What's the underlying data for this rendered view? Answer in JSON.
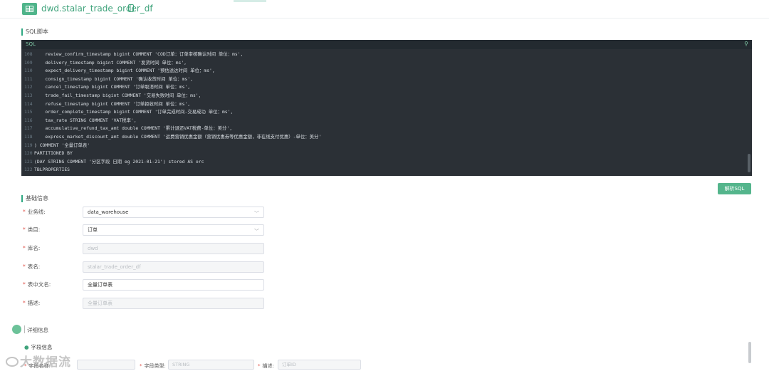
{
  "header": {
    "table_name": "dwd.stalar_trade_order_df"
  },
  "sql_section": {
    "title": "SQL脚本",
    "editor_label": "SQL",
    "lines": [
      {
        "n": "108",
        "code": "    review_confirm_timestamp bigint COMMENT 'COD订单：订单审核确认时间 单位：ms',"
      },
      {
        "n": "109",
        "code": "    delivery_timestamp bigint COMMENT '发货时间 单位：ms',"
      },
      {
        "n": "110",
        "code": "    expect_delivery_timestamp bigint COMMENT '预估送达时间 单位：ms',"
      },
      {
        "n": "111",
        "code": "    consign_timestamp bigint COMMENT '确认收货时间 单位：ms',"
      },
      {
        "n": "112",
        "code": "    cancel_timestamp bigint COMMENT '订单取消时间 单位：ms',"
      },
      {
        "n": "113",
        "code": "    trade_fail_timestamp bigint COMMENT '交易失败时间 单位：ms',"
      },
      {
        "n": "114",
        "code": "    refuse_timestamp bigint COMMENT '订单拒收时间 单位：ms',"
      },
      {
        "n": "115",
        "code": "    order_complete_timestamp bigint COMMENT '订单完成时间-交易成功 单位：ms',"
      },
      {
        "n": "116",
        "code": "    tax_rate STRING COMMENT 'VAT税率',"
      },
      {
        "n": "117",
        "code": "    accumulative_refund_tax_amt double COMMENT '累计退还VAT税费-单位：美分',"
      },
      {
        "n": "118",
        "code": "    express_market_discount_amt double COMMENT '运费营销优惠金额（营销优惠券等优惠金额，非在线支付优惠）-单位：美分'"
      },
      {
        "n": "119",
        "code": ") COMMENT '全量订单表'"
      },
      {
        "n": "120",
        "code": "PARTITIONED BY"
      },
      {
        "n": "121",
        "code": "(DAY STRING COMMENT '分区字段 日期 eg 2021-01-21') stored AS orc"
      },
      {
        "n": "122",
        "code": "TBLPROPERTIES"
      }
    ],
    "parse_button": "解析SQL"
  },
  "basic_info": {
    "title": "基础信息",
    "fields": [
      {
        "label": "业务线:",
        "value": "data_warehouse",
        "type": "select"
      },
      {
        "label": "类目:",
        "value": "订单",
        "type": "select"
      },
      {
        "label": "库名:",
        "value": "dwd",
        "type": "disabled"
      },
      {
        "label": "表名:",
        "value": "stalar_trade_order_df",
        "type": "disabled"
      },
      {
        "label": "表中文名:",
        "value": "全量订单表",
        "type": "text"
      },
      {
        "label": "描述:",
        "value": "全量订单表",
        "type": "disabled"
      }
    ]
  },
  "detail_info": {
    "title": "详细信息",
    "field_info_title": "字段信息",
    "row": [
      {
        "label": "字段名称:",
        "value": ""
      },
      {
        "label": "字段类型:",
        "value": "STRING"
      },
      {
        "label": "描述:",
        "value": "订单ID"
      }
    ]
  },
  "watermark": "大数据流"
}
